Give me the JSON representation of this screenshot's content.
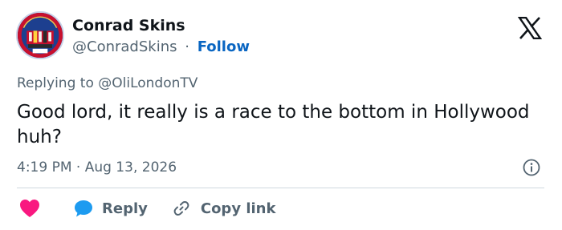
{
  "author": {
    "name": "Conrad Skins",
    "handle": "@ConradSkins",
    "separator": "·",
    "follow_label": "Follow",
    "avatar_badge_text": "FA CUP WINNERS",
    "avatar_year": "2025"
  },
  "reply_context": {
    "prefix": "Replying to ",
    "mention": "@OliLondonTV"
  },
  "tweet": {
    "text": "Good lord, it really is a race to the bottom in Hollywood huh?",
    "timestamp": "4:19 PM · Aug 13, 2026"
  },
  "actions": {
    "reply_label": "Reply",
    "copy_label": "Copy link"
  },
  "icons": {
    "brand": "x-logo-icon",
    "info": "info-icon",
    "like": "heart-icon",
    "reply": "speech-bubble-icon",
    "copy": "link-icon"
  },
  "colors": {
    "text": "#0f1419",
    "muted": "#536471",
    "follow": "#0a66c2",
    "heart": "#f91880",
    "bubble": "#1d9bf0",
    "divider": "#cfd9de"
  }
}
